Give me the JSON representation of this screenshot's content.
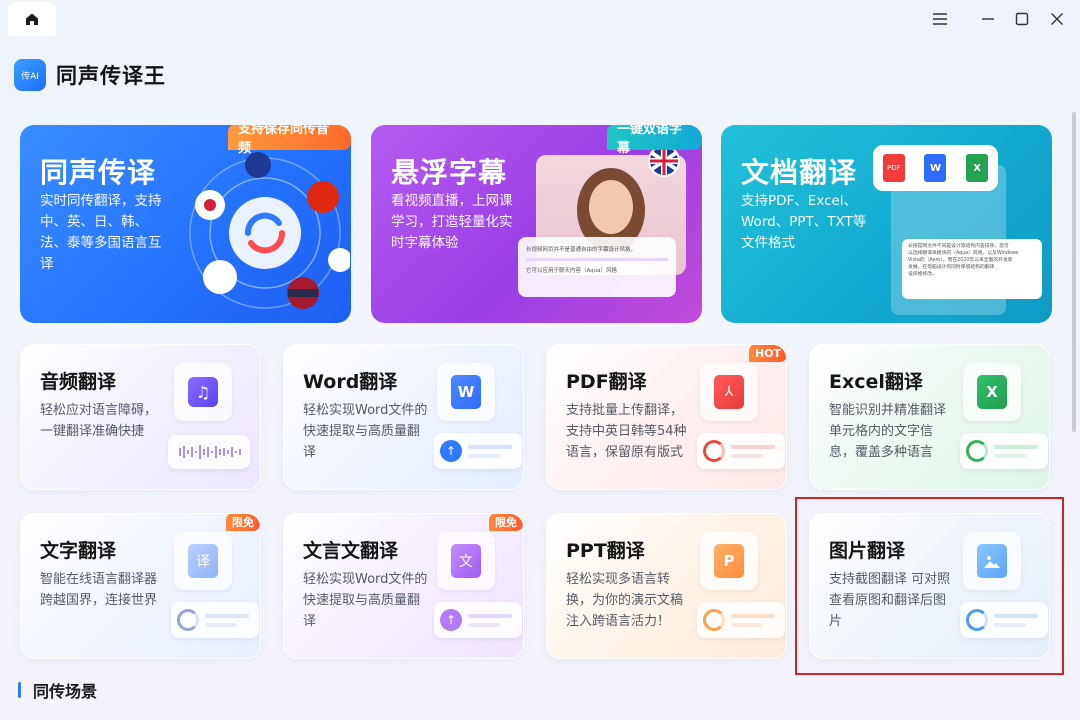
{
  "app": {
    "title": "同声传译王",
    "logo_text": "传AI"
  },
  "window": {
    "controls": [
      "menu-icon",
      "minimize-icon",
      "maximize-icon",
      "close-icon"
    ]
  },
  "hero_cards": [
    {
      "title": "同声传译",
      "desc_lines": [
        "实时同传翻译，支持",
        "中、英、日、韩、",
        "法、泰等多国语言互",
        "译"
      ],
      "ribbon": "支持保存同传音频",
      "color": "#2f7bff"
    },
    {
      "title": "悬浮字幕",
      "desc_lines": [
        "看视频直播，上网课",
        "学习，打造轻量化实",
        "时字幕体验"
      ],
      "ribbon": "一键双语字幕",
      "color": "#a44be8",
      "subtitle_lines": [
        "长视频网页并不是普通自由的字幕设计风格，",
        "它可以应用于聊天内容（Aqua）风格"
      ]
    },
    {
      "title": "文档翻译",
      "desc_lines": [
        "支持PDF、Excel、",
        "Word、PPT、TXT等",
        "文件格式"
      ],
      "color": "#1bb3d6",
      "doc_icons": [
        "PDF",
        "W",
        "X"
      ],
      "doc_lines": [
        "长按提网文件不同是设计等结构内容排序，您可",
        "以选择翻译单模块的（Aqua）风格，以及Windows",
        "Vista的（Aero）。而在2020年以来全面的开发新",
        "发展。在电脑设计的同时保留结构的翻译",
        "设风格修改。"
      ]
    }
  ],
  "tiles": [
    {
      "title": "音频翻译",
      "desc": "轻松应对语言障碍，一键翻译准确快捷",
      "icon": "music-icon",
      "badge": ""
    },
    {
      "title": "Word翻译",
      "desc": "轻松实现Word文件的快速提取与高质量翻译",
      "icon": "W",
      "badge": ""
    },
    {
      "title": "PDF翻译",
      "desc": "支持批量上传翻译，支持中英日韩等54种语言，保留原有版式",
      "icon": "pdf-icon",
      "badge": "HOT"
    },
    {
      "title": "Excel翻译",
      "desc": "智能识别并精准翻译单元格内的文字信息，覆盖多种语言",
      "icon": "X",
      "badge": ""
    },
    {
      "title": "文字翻译",
      "desc": "智能在线语言翻译器跨越国界，连接世界",
      "icon": "译",
      "badge": "限免"
    },
    {
      "title": "文言文翻译",
      "desc": "轻松实现Word文件的快速提取与高质量翻译",
      "icon": "文",
      "badge": "限免"
    },
    {
      "title": "PPT翻译",
      "desc": "轻松实现多语言转换，为你的演示文稿注入跨语言活力！",
      "icon": "P",
      "badge": ""
    },
    {
      "title": "图片翻译",
      "desc": "支持截图翻译 可对照查看原图和翻译后图片",
      "icon": "image-icon",
      "badge": ""
    }
  ],
  "section": {
    "title": "同传场景"
  }
}
